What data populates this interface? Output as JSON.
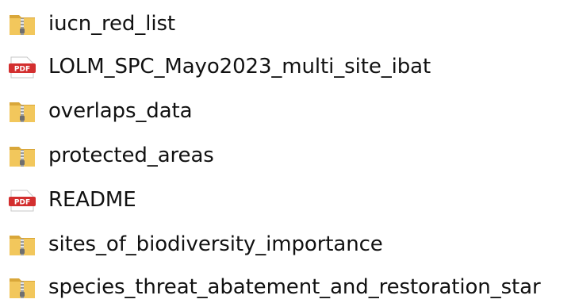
{
  "files": [
    {
      "name": "iucn_red_list",
      "type": "zip-folder",
      "icon": "zip-folder-icon"
    },
    {
      "name": "LOLM_SPC_Mayo2023_multi_site_ibat",
      "type": "pdf",
      "icon": "pdf-icon"
    },
    {
      "name": "overlaps_data",
      "type": "zip-folder",
      "icon": "zip-folder-icon"
    },
    {
      "name": "protected_areas",
      "type": "zip-folder",
      "icon": "zip-folder-icon"
    },
    {
      "name": "README",
      "type": "pdf",
      "icon": "pdf-icon"
    },
    {
      "name": "sites_of_biodiversity_importance",
      "type": "zip-folder",
      "icon": "zip-folder-icon"
    },
    {
      "name": "species_threat_abatement_and_restoration_star",
      "type": "zip-folder",
      "icon": "zip-folder-icon"
    }
  ],
  "colors": {
    "text": "#111111",
    "folder_yellow": "#f2c75c",
    "folder_dark": "#d9a73a",
    "zipper": "#8c8c8c",
    "pdf_red": "#d32f2f"
  },
  "icon_labels": {
    "pdf": "PDF"
  }
}
